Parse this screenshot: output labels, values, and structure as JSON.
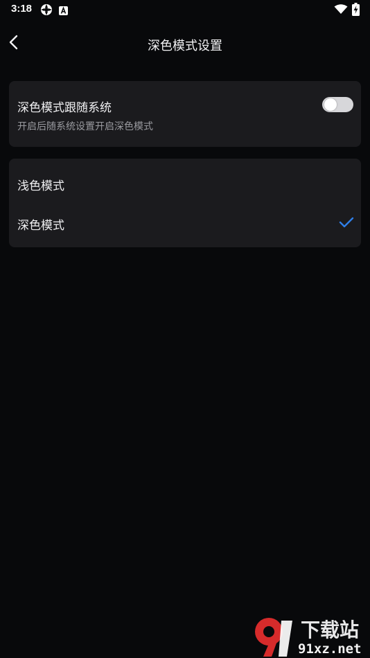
{
  "status_bar": {
    "time": "3:18",
    "icons": [
      "sync-icon",
      "a-badge-icon",
      "wifi-icon",
      "battery-charging-icon"
    ]
  },
  "header": {
    "title": "深色模式设置",
    "back_icon": "chevron-left-icon"
  },
  "follow_system": {
    "title": "深色模式跟随系统",
    "subtitle": "开启后随系统设置开启深色模式",
    "enabled": false
  },
  "modes": {
    "items": [
      {
        "label": "浅色模式",
        "selected": false
      },
      {
        "label": "深色模式",
        "selected": true
      }
    ],
    "check_icon": "checkmark-icon"
  },
  "colors": {
    "background": "#08090b",
    "card": "#1b1b1e",
    "accent": "#2f7fe8",
    "watermark_red": "#d62b2b"
  },
  "watermark": {
    "logo": "9",
    "top_text": "下载站",
    "bottom_text": "91xz.net"
  }
}
